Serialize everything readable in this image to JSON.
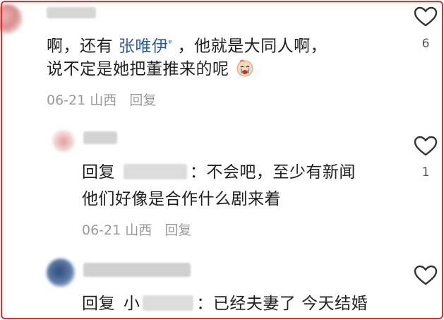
{
  "comments": [
    {
      "text_line1_pre": "啊，还有",
      "mention": "张唯伊",
      "mention_icon": "search-icon",
      "text_line1_post": "，他就是大同人啊，",
      "text_line2": "说不定是她把董推来的呢",
      "emoji": "crying-face-emoji",
      "date": "06-21",
      "location": "山西",
      "reply_label": "回复",
      "likes": "6"
    },
    {
      "reply_prefix": "回复",
      "colon": "：",
      "text_line1": "不会吧，至少有新闻",
      "text_line2": "他们好像是合作什么剧来着",
      "date": "06-21",
      "location": "山西",
      "reply_label": "回复",
      "likes": "1"
    },
    {
      "reply_prefix": "回复",
      "blurred_name_start": "小",
      "colon": "：",
      "text_line1": "已经夫妻了 今天结婚",
      "likes": ""
    }
  ],
  "colors": {
    "text": "#1f1f1f",
    "meta": "#9a9a9a",
    "mention": "#2b5c9e",
    "frame": "#e0302e",
    "heart": "#333333"
  },
  "icons": [
    "heart-outline-icon",
    "crying-face-emoji",
    "search-icon"
  ]
}
